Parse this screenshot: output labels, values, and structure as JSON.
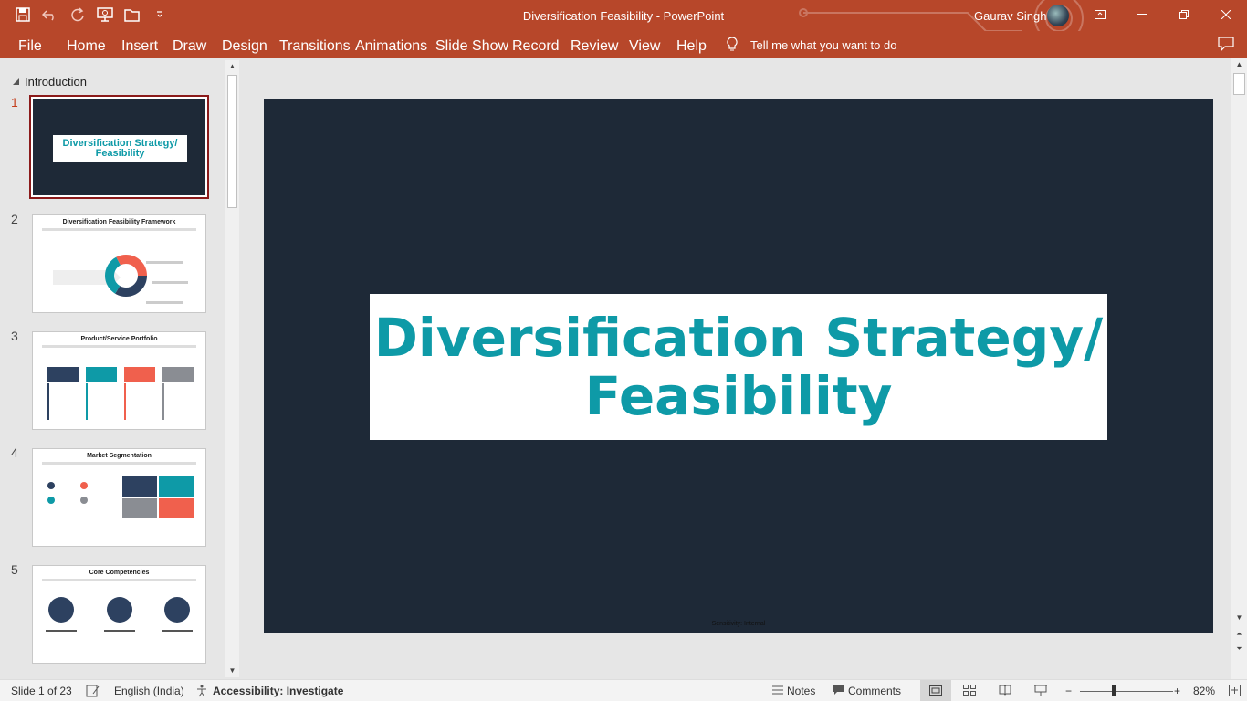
{
  "window": {
    "title": "Diversification Feasibility  -  PowerPoint",
    "user": "Gaurav Singh",
    "accent": "#b7472a"
  },
  "ribbon": {
    "tabs": [
      "File",
      "Home",
      "Insert",
      "Draw",
      "Design",
      "Transitions",
      "Animations",
      "Slide Show",
      "Record",
      "Review",
      "View",
      "Help"
    ],
    "tell_me": "Tell me what you want to do"
  },
  "thumbnails": {
    "section": "Introduction",
    "items": [
      {
        "num": "1",
        "title": "Diversification Strategy/ Feasibility"
      },
      {
        "num": "2",
        "title": "Diversification Feasibility Framework"
      },
      {
        "num": "3",
        "title": "Product/Service Portfolio"
      },
      {
        "num": "4",
        "title": "Market Segmentation"
      },
      {
        "num": "5",
        "title": "Core Competencies"
      }
    ]
  },
  "slide": {
    "title_line1": "Diversification Strategy/",
    "title_line2": "Feasibility",
    "sensitivity": "Sensitivity: Internal",
    "background": "#1e2937",
    "title_color": "#0e9aa7"
  },
  "status": {
    "slide_info": "Slide 1 of 23",
    "language": "English (India)",
    "accessibility": "Accessibility: Investigate",
    "notes": "Notes",
    "comments": "Comments",
    "zoom": "82%"
  }
}
